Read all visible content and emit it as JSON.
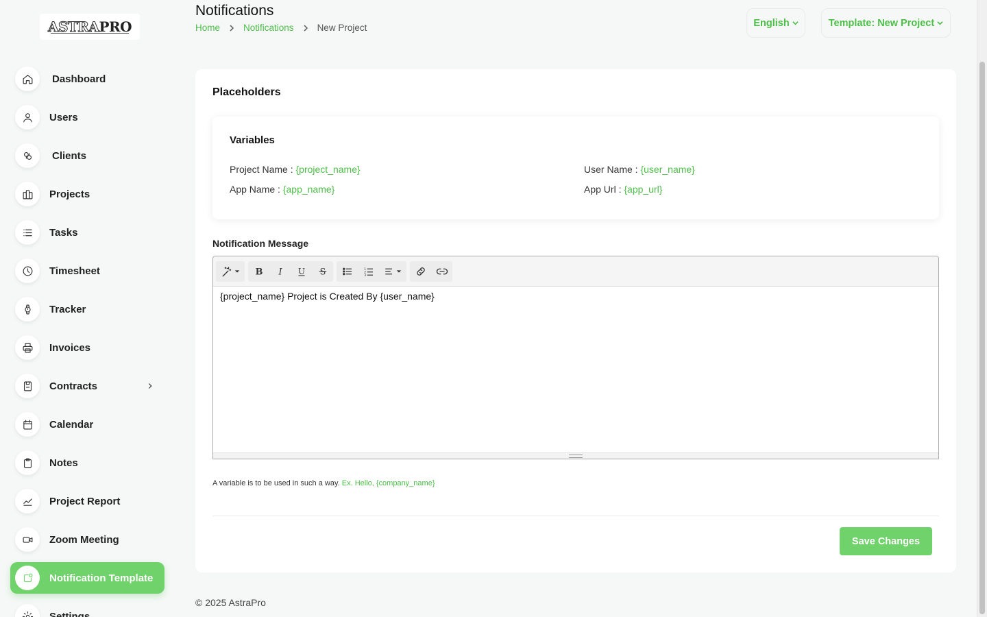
{
  "brand": {
    "logo_text_a": "ASTRA",
    "logo_text_b": "PRO",
    "accent": "#6fd26a",
    "link_color": "#4cbf47"
  },
  "sidebar": {
    "items": [
      {
        "label": "Dashboard",
        "icon": "home-icon"
      },
      {
        "label": "Users",
        "icon": "user-icon"
      },
      {
        "label": "Clients",
        "icon": "clients-icon"
      },
      {
        "label": "Projects",
        "icon": "projects-icon"
      },
      {
        "label": "Tasks",
        "icon": "list-icon"
      },
      {
        "label": "Timesheet",
        "icon": "clock-icon"
      },
      {
        "label": "Tracker",
        "icon": "watch-icon"
      },
      {
        "label": "Invoices",
        "icon": "printer-icon"
      },
      {
        "label": "Contracts",
        "icon": "contract-icon"
      },
      {
        "label": "Calendar",
        "icon": "calendar-icon"
      },
      {
        "label": "Notes",
        "icon": "clipboard-icon"
      },
      {
        "label": "Project Report",
        "icon": "chart-line-icon"
      },
      {
        "label": "Zoom Meeting",
        "icon": "video-icon"
      },
      {
        "label": "Notification Template",
        "icon": "notification-icon",
        "active": true
      },
      {
        "label": "Settings",
        "icon": "gear-icon"
      }
    ]
  },
  "header": {
    "title": "Notifications",
    "breadcrumb": {
      "home": "Home",
      "parent": "Notifications",
      "current": "New Project"
    },
    "language_button": "English",
    "template_button": "Template: New Project"
  },
  "placeholders": {
    "title": "Placeholders",
    "variables_title": "Variables",
    "variables": [
      {
        "label": "Project Name :",
        "value": "{project_name}"
      },
      {
        "label": "User Name :",
        "value": "{user_name}"
      },
      {
        "label": "App Name :",
        "value": "{app_name}"
      },
      {
        "label": "App Url :",
        "value": "{app_url}"
      }
    ]
  },
  "message": {
    "label": "Notification Message",
    "content": "{project_name} Project is Created By {user_name}",
    "toolbar": [
      "magic-wand-icon",
      "bold-icon",
      "italic-icon",
      "underline-icon",
      "strikethrough-icon",
      "bullet-list-icon",
      "numbered-list-icon",
      "align-icon",
      "link-icon",
      "unlink-icon"
    ]
  },
  "hint": {
    "text": "A variable is to be used in such a way.",
    "example": "Ex. Hello, {company_name}"
  },
  "save_button": "Save Changes",
  "footer": "© 2025 AstraPro"
}
